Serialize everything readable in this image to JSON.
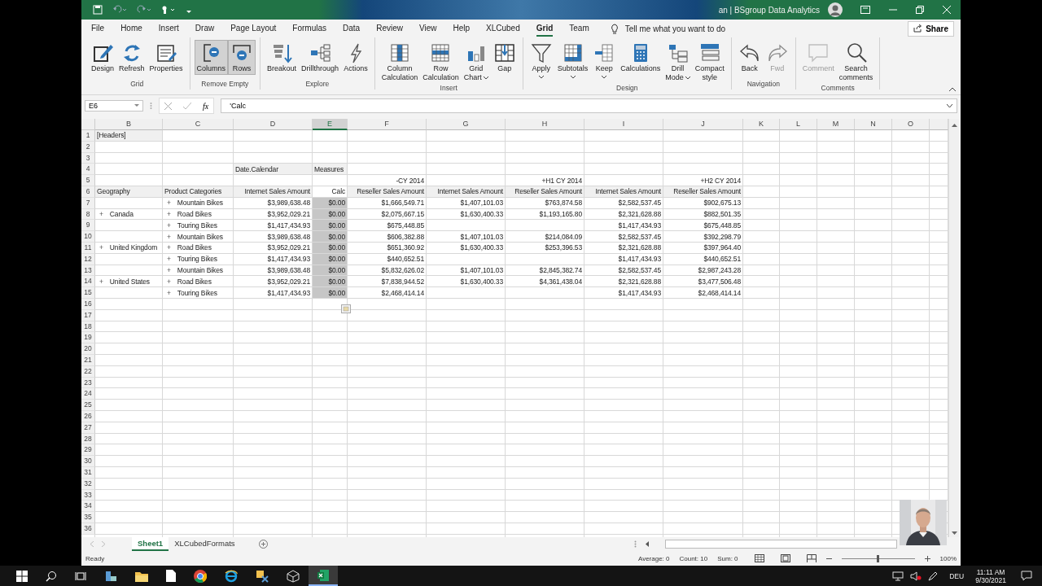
{
  "title_bar": {
    "title": "an | BSgroup Data Analytics"
  },
  "ribbon_tabs": [
    {
      "label": "File",
      "selected": false
    },
    {
      "label": "Home",
      "selected": false
    },
    {
      "label": "Insert",
      "selected": false
    },
    {
      "label": "Draw",
      "selected": false
    },
    {
      "label": "Page Layout",
      "selected": false
    },
    {
      "label": "Formulas",
      "selected": false
    },
    {
      "label": "Data",
      "selected": false
    },
    {
      "label": "Review",
      "selected": false
    },
    {
      "label": "View",
      "selected": false
    },
    {
      "label": "Help",
      "selected": false
    },
    {
      "label": "XLCubed",
      "selected": false
    },
    {
      "label": "Grid",
      "selected": true
    },
    {
      "label": "Team",
      "selected": false
    }
  ],
  "tell_me": {
    "placeholder": "Tell me what you want to do"
  },
  "share_button": "Share",
  "ribbon_groups": [
    {
      "label": "Grid",
      "buttons": [
        {
          "lines": [
            "Design"
          ],
          "on": false,
          "disabled": false,
          "dropdown": false
        },
        {
          "lines": [
            "Refresh"
          ],
          "on": false,
          "disabled": false,
          "dropdown": false
        },
        {
          "lines": [
            "Properties"
          ],
          "on": false,
          "disabled": false,
          "dropdown": false
        }
      ]
    },
    {
      "label": "Remove Empty",
      "buttons": [
        {
          "lines": [
            "Columns"
          ],
          "on": true,
          "disabled": false,
          "dropdown": false
        },
        {
          "lines": [
            "Rows"
          ],
          "on": true,
          "disabled": false,
          "dropdown": false
        }
      ]
    },
    {
      "label": "Explore",
      "buttons": [
        {
          "lines": [
            "Breakout"
          ],
          "on": false,
          "disabled": false,
          "dropdown": false
        },
        {
          "lines": [
            "Drillthrough"
          ],
          "on": false,
          "disabled": false,
          "dropdown": false
        },
        {
          "lines": [
            "Actions"
          ],
          "on": false,
          "disabled": false,
          "dropdown": false
        }
      ]
    },
    {
      "label": "Insert",
      "buttons": [
        {
          "lines": [
            "Column",
            "Calculation"
          ],
          "on": false,
          "disabled": false,
          "dropdown": false
        },
        {
          "lines": [
            "Row",
            "Calculation"
          ],
          "on": false,
          "disabled": false,
          "dropdown": false
        },
        {
          "lines": [
            "Grid",
            "Chart"
          ],
          "on": false,
          "disabled": false,
          "dropdown": true
        },
        {
          "lines": [
            "Gap"
          ],
          "on": false,
          "disabled": false,
          "dropdown": false
        }
      ]
    },
    {
      "label": "Design",
      "buttons": [
        {
          "lines": [
            "Apply"
          ],
          "on": false,
          "disabled": false,
          "dropdown": true
        },
        {
          "lines": [
            "Subtotals"
          ],
          "on": false,
          "disabled": false,
          "dropdown": true
        },
        {
          "lines": [
            "Keep"
          ],
          "on": false,
          "disabled": false,
          "dropdown": true
        },
        {
          "lines": [
            "Calculations"
          ],
          "on": false,
          "disabled": false,
          "dropdown": false
        },
        {
          "lines": [
            "Drill",
            "Mode"
          ],
          "on": false,
          "disabled": false,
          "dropdown": true
        },
        {
          "lines": [
            "Compact",
            "style"
          ],
          "on": false,
          "disabled": false,
          "dropdown": false
        }
      ]
    },
    {
      "label": "Navigation",
      "buttons": [
        {
          "lines": [
            "Back"
          ],
          "on": false,
          "disabled": false,
          "dropdown": false
        },
        {
          "lines": [
            "Fwd"
          ],
          "on": false,
          "disabled": true,
          "dropdown": false
        }
      ]
    },
    {
      "label": "Comments",
      "buttons": [
        {
          "lines": [
            "Comment"
          ],
          "on": false,
          "disabled": true,
          "dropdown": false
        },
        {
          "lines": [
            "Search",
            "comments"
          ],
          "on": false,
          "disabled": false,
          "dropdown": false
        }
      ]
    }
  ],
  "formula_bar": {
    "name_box": "E6",
    "function_label": "fx",
    "formula": "'Calc"
  },
  "grid": {
    "columns": [
      {
        "label": "B",
        "selected": false
      },
      {
        "label": "C",
        "selected": false
      },
      {
        "label": "D",
        "selected": false
      },
      {
        "label": "E",
        "selected": true
      },
      {
        "label": "F",
        "selected": false
      },
      {
        "label": "G",
        "selected": false
      },
      {
        "label": "H",
        "selected": false
      },
      {
        "label": "I",
        "selected": false
      },
      {
        "label": "J",
        "selected": false
      },
      {
        "label": "K",
        "selected": false
      },
      {
        "label": "L",
        "selected": false
      },
      {
        "label": "M",
        "selected": false
      },
      {
        "label": "N",
        "selected": false
      },
      {
        "label": "O",
        "selected": false
      },
      {
        "selected": false
      }
    ],
    "rows": [
      {
        "number": "1",
        "cells": [
          {
            "text": "[Headers]",
            "kind": "text",
            "shaded": true,
            "selected": false
          },
          null,
          null,
          null,
          null,
          null,
          null,
          null,
          null,
          null,
          null,
          null,
          null,
          null,
          null
        ]
      },
      {
        "number": "2"
      },
      {
        "number": "3"
      },
      {
        "number": "4",
        "cells": [
          null,
          null,
          {
            "text": "Date.Calendar",
            "kind": "text",
            "shaded": true,
            "selected": false
          },
          {
            "text": "Measures",
            "kind": "text",
            "shaded": true,
            "selected": false
          },
          null,
          null,
          null,
          null,
          null,
          null,
          null,
          null,
          null,
          null,
          null
        ]
      },
      {
        "number": "5",
        "cells": [
          null,
          null,
          null,
          null,
          {
            "text": "-CY 2014",
            "kind": "heading",
            "shaded": false,
            "selected": false
          },
          null,
          {
            "text": "+H1 CY 2014",
            "kind": "heading",
            "shaded": false,
            "selected": false
          },
          null,
          {
            "text": "+H2 CY 2014",
            "kind": "heading",
            "shaded": false,
            "selected": false
          },
          null,
          null,
          null,
          null,
          null,
          null
        ]
      },
      {
        "number": "6",
        "cells": [
          {
            "text": "Geography",
            "kind": "text",
            "shaded": true,
            "selected": false
          },
          {
            "text": "Product Categories",
            "kind": "text",
            "shaded": true,
            "selected": false
          },
          {
            "text": "Internet Sales Amount",
            "kind": "heading",
            "shaded": true,
            "selected": false
          },
          {
            "text": "Calc",
            "kind": "heading",
            "shaded": false,
            "selected": false
          },
          {
            "text": "Reseller Sales Amount",
            "kind": "heading",
            "shaded": true,
            "selected": false
          },
          {
            "text": "Internet Sales Amount",
            "kind": "heading",
            "shaded": true,
            "selected": false
          },
          {
            "text": "Reseller Sales Amount",
            "kind": "heading",
            "shaded": true,
            "selected": false
          },
          {
            "text": "Internet Sales Amount",
            "kind": "heading",
            "shaded": true,
            "selected": false
          },
          {
            "text": "Reseller Sales Amount",
            "kind": "heading",
            "shaded": true,
            "selected": false
          },
          null,
          null,
          null,
          null,
          null,
          null
        ]
      },
      {
        "number": "7",
        "cells": [
          null,
          {
            "text": "Mountain Bikes",
            "expander": "+",
            "kind": "text",
            "shaded": false,
            "selected": false
          },
          {
            "text": "$3,989,638.48",
            "kind": "amount",
            "shaded": false,
            "selected": false
          },
          {
            "text": "$0.00",
            "kind": "amount",
            "shaded": false,
            "selected": true
          },
          {
            "text": "$1,666,549.71",
            "kind": "amount",
            "shaded": false,
            "selected": false
          },
          {
            "text": "$1,407,101.03",
            "kind": "amount",
            "shaded": false,
            "selected": false
          },
          {
            "text": "$763,874.58",
            "kind": "amount",
            "shaded": false,
            "selected": false
          },
          {
            "text": "$2,582,537.45",
            "kind": "amount",
            "shaded": false,
            "selected": false
          },
          {
            "text": "$902,675.13",
            "kind": "amount",
            "shaded": false,
            "selected": false
          },
          null,
          null,
          null,
          null,
          null,
          null
        ]
      },
      {
        "number": "8",
        "cells": [
          {
            "text": "Canada",
            "expander": "+",
            "kind": "text",
            "shaded": false,
            "selected": false
          },
          {
            "text": "Road Bikes",
            "expander": "+",
            "kind": "text",
            "shaded": false,
            "selected": false
          },
          {
            "text": "$3,952,029.21",
            "kind": "amount",
            "shaded": false,
            "selected": false
          },
          {
            "text": "$0.00",
            "kind": "amount",
            "shaded": false,
            "selected": true
          },
          {
            "text": "$2,075,667.15",
            "kind": "amount",
            "shaded": false,
            "selected": false
          },
          {
            "text": "$1,630,400.33",
            "kind": "amount",
            "shaded": false,
            "selected": false
          },
          {
            "text": "$1,193,165.80",
            "kind": "amount",
            "shaded": false,
            "selected": false
          },
          {
            "text": "$2,321,628.88",
            "kind": "amount",
            "shaded": false,
            "selected": false
          },
          {
            "text": "$882,501.35",
            "kind": "amount",
            "shaded": false,
            "selected": false
          },
          null,
          null,
          null,
          null,
          null,
          null
        ]
      },
      {
        "number": "9",
        "cells": [
          null,
          {
            "text": "Touring Bikes",
            "expander": "+",
            "kind": "text",
            "shaded": false,
            "selected": false
          },
          {
            "text": "$1,417,434.93",
            "kind": "amount",
            "shaded": false,
            "selected": false
          },
          {
            "text": "$0.00",
            "kind": "amount",
            "shaded": false,
            "selected": true
          },
          {
            "text": "$675,448.85",
            "kind": "amount",
            "shaded": false,
            "selected": false
          },
          null,
          null,
          {
            "text": "$1,417,434.93",
            "kind": "amount",
            "shaded": false,
            "selected": false
          },
          {
            "text": "$675,448.85",
            "kind": "amount",
            "shaded": false,
            "selected": false
          },
          null,
          null,
          null,
          null,
          null,
          null
        ]
      },
      {
        "number": "10",
        "cells": [
          null,
          {
            "text": "Mountain Bikes",
            "expander": "+",
            "kind": "text",
            "shaded": false,
            "selected": false
          },
          {
            "text": "$3,989,638.48",
            "kind": "amount",
            "shaded": false,
            "selected": false
          },
          {
            "text": "$0.00",
            "kind": "amount",
            "shaded": false,
            "selected": true
          },
          {
            "text": "$606,382.88",
            "kind": "amount",
            "shaded": false,
            "selected": false
          },
          {
            "text": "$1,407,101.03",
            "kind": "amount",
            "shaded": false,
            "selected": false
          },
          {
            "text": "$214,084.09",
            "kind": "amount",
            "shaded": false,
            "selected": false
          },
          {
            "text": "$2,582,537.45",
            "kind": "amount",
            "shaded": false,
            "selected": false
          },
          {
            "text": "$392,298.79",
            "kind": "amount",
            "shaded": false,
            "selected": false
          },
          null,
          null,
          null,
          null,
          null,
          null
        ]
      },
      {
        "number": "11",
        "cells": [
          {
            "text": "United Kingdom",
            "expander": "+",
            "kind": "text",
            "shaded": false,
            "selected": false
          },
          {
            "text": "Road Bikes",
            "expander": "+",
            "kind": "text",
            "shaded": false,
            "selected": false
          },
          {
            "text": "$3,952,029.21",
            "kind": "amount",
            "shaded": false,
            "selected": false
          },
          {
            "text": "$0.00",
            "kind": "amount",
            "shaded": false,
            "selected": true
          },
          {
            "text": "$651,360.92",
            "kind": "amount",
            "shaded": false,
            "selected": false
          },
          {
            "text": "$1,630,400.33",
            "kind": "amount",
            "shaded": false,
            "selected": false
          },
          {
            "text": "$253,396.53",
            "kind": "amount",
            "shaded": false,
            "selected": false
          },
          {
            "text": "$2,321,628.88",
            "kind": "amount",
            "shaded": false,
            "selected": false
          },
          {
            "text": "$397,964.40",
            "kind": "amount",
            "shaded": false,
            "selected": false
          },
          null,
          null,
          null,
          null,
          null,
          null
        ]
      },
      {
        "number": "12",
        "cells": [
          null,
          {
            "text": "Touring Bikes",
            "expander": "+",
            "kind": "text",
            "shaded": false,
            "selected": false
          },
          {
            "text": "$1,417,434.93",
            "kind": "amount",
            "shaded": false,
            "selected": false
          },
          {
            "text": "$0.00",
            "kind": "amount",
            "shaded": false,
            "selected": true
          },
          {
            "text": "$440,652.51",
            "kind": "amount",
            "shaded": false,
            "selected": false
          },
          null,
          null,
          {
            "text": "$1,417,434.93",
            "kind": "amount",
            "shaded": false,
            "selected": false
          },
          {
            "text": "$440,652.51",
            "kind": "amount",
            "shaded": false,
            "selected": false
          },
          null,
          null,
          null,
          null,
          null,
          null
        ]
      },
      {
        "number": "13",
        "cells": [
          null,
          {
            "text": "Mountain Bikes",
            "expander": "+",
            "kind": "text",
            "shaded": false,
            "selected": false
          },
          {
            "text": "$3,989,638.48",
            "kind": "amount",
            "shaded": false,
            "selected": false
          },
          {
            "text": "$0.00",
            "kind": "amount",
            "shaded": false,
            "selected": true
          },
          {
            "text": "$5,832,626.02",
            "kind": "amount",
            "shaded": false,
            "selected": false
          },
          {
            "text": "$1,407,101.03",
            "kind": "amount",
            "shaded": false,
            "selected": false
          },
          {
            "text": "$2,845,382.74",
            "kind": "amount",
            "shaded": false,
            "selected": false
          },
          {
            "text": "$2,582,537.45",
            "kind": "amount",
            "shaded": false,
            "selected": false
          },
          {
            "text": "$2,987,243.28",
            "kind": "amount",
            "shaded": false,
            "selected": false
          },
          null,
          null,
          null,
          null,
          null,
          null
        ]
      },
      {
        "number": "14",
        "cells": [
          {
            "text": "United States",
            "expander": "+",
            "kind": "text",
            "shaded": false,
            "selected": false
          },
          {
            "text": "Road Bikes",
            "expander": "+",
            "kind": "text",
            "shaded": false,
            "selected": false
          },
          {
            "text": "$3,952,029.21",
            "kind": "amount",
            "shaded": false,
            "selected": false
          },
          {
            "text": "$0.00",
            "kind": "amount",
            "shaded": false,
            "selected": true
          },
          {
            "text": "$7,838,944.52",
            "kind": "amount",
            "shaded": false,
            "selected": false
          },
          {
            "text": "$1,630,400.33",
            "kind": "amount",
            "shaded": false,
            "selected": false
          },
          {
            "text": "$4,361,438.04",
            "kind": "amount",
            "shaded": false,
            "selected": false
          },
          {
            "text": "$2,321,628.88",
            "kind": "amount",
            "shaded": false,
            "selected": false
          },
          {
            "text": "$3,477,506.48",
            "kind": "amount",
            "shaded": false,
            "selected": false
          },
          null,
          null,
          null,
          null,
          null,
          null
        ]
      },
      {
        "number": "15",
        "cells": [
          null,
          {
            "text": "Touring Bikes",
            "expander": "+",
            "kind": "text",
            "shaded": false,
            "selected": false
          },
          {
            "text": "$1,417,434.93",
            "kind": "amount",
            "shaded": false,
            "selected": false
          },
          {
            "text": "$0.00",
            "kind": "amount",
            "shaded": false,
            "selected": true
          },
          {
            "text": "$2,468,414.14",
            "kind": "amount",
            "shaded": false,
            "selected": false
          },
          null,
          null,
          {
            "text": "$1,417,434.93",
            "kind": "amount",
            "shaded": false,
            "selected": false
          },
          {
            "text": "$2,468,414.14",
            "kind": "amount",
            "shaded": false,
            "selected": false
          },
          null,
          null,
          null,
          null,
          null,
          null
        ]
      },
      {
        "number": "16"
      },
      {
        "number": "17"
      },
      {
        "number": "18"
      },
      {
        "number": "19"
      },
      {
        "number": "20"
      },
      {
        "number": "21"
      },
      {
        "number": "22"
      },
      {
        "number": "23"
      },
      {
        "number": "24"
      },
      {
        "number": "25"
      },
      {
        "number": "26"
      },
      {
        "number": "27"
      },
      {
        "number": "28"
      },
      {
        "number": "29"
      },
      {
        "number": "30"
      },
      {
        "number": "31"
      },
      {
        "number": "32"
      },
      {
        "number": "33"
      },
      {
        "number": "34"
      },
      {
        "number": "35"
      },
      {
        "number": "36"
      }
    ]
  },
  "sheet_tabs": [
    {
      "label": "Sheet1",
      "selected": true
    },
    {
      "label": "XLCubedFormats",
      "selected": false
    }
  ],
  "status_bar": {
    "mode": "Ready",
    "average": "Average: 0",
    "count": "Count: 10",
    "sum": "Sum: 0",
    "zoom": {
      "level": 0.5,
      "reading": "100%"
    }
  },
  "taskbar": {
    "language": "DEU",
    "time": "11:11 AM",
    "date": "9/30/2021"
  }
}
